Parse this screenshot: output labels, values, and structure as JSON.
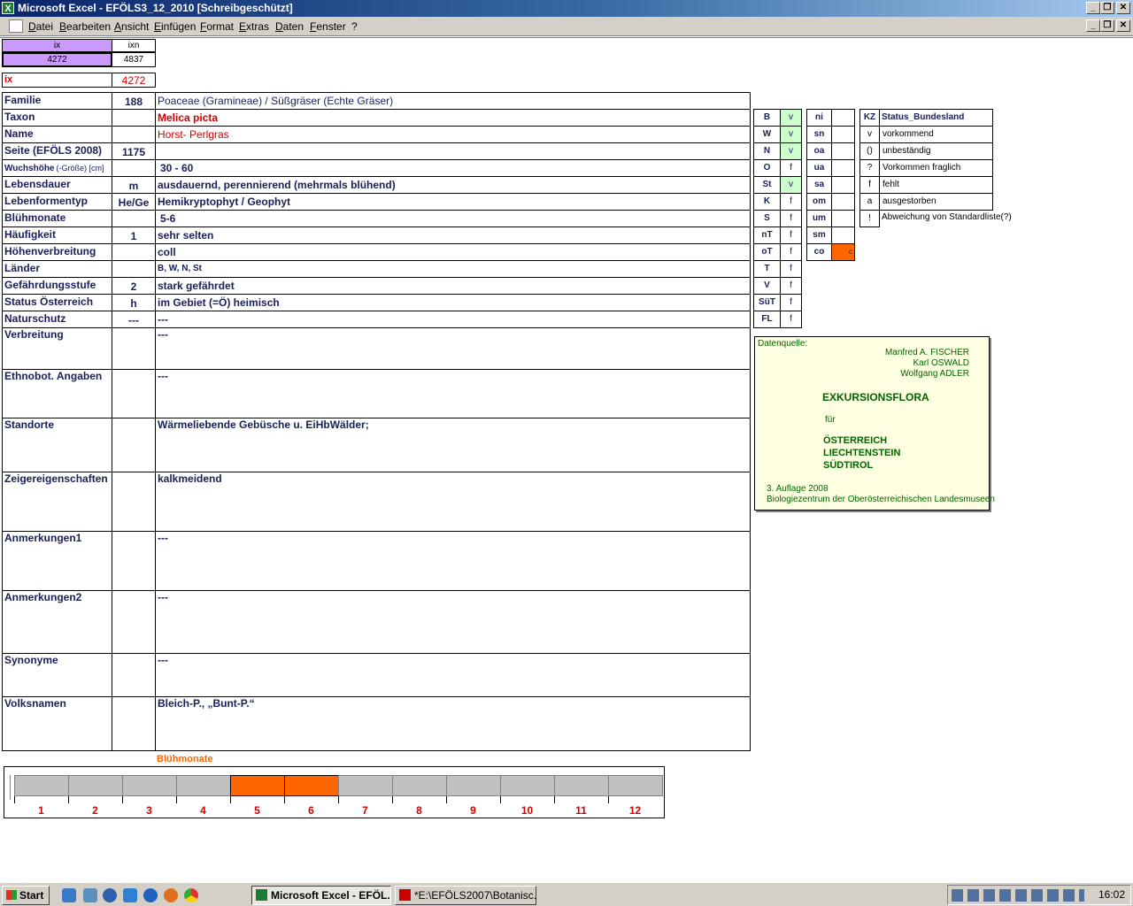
{
  "window": {
    "title": "Microsoft Excel - EFÖLS3_12_2010  [Schreibgeschützt]"
  },
  "menu": [
    "Datei",
    "Bearbeiten",
    "Ansicht",
    "Einfügen",
    "Format",
    "Extras",
    "Daten",
    "Fenster",
    "?"
  ],
  "index": {
    "ix_label": "ix",
    "ixn_label": "ixn",
    "ix_value": "4272",
    "ixn_value": "4837",
    "ix_row_label": "ix",
    "ix_row_value": "4272"
  },
  "fields": [
    {
      "label": "Familie",
      "code": "188",
      "value": "Poaceae (Gramineae)  /  Süßgräser (Echte Gräser)"
    },
    {
      "label": "Taxon",
      "code": "",
      "value": "Melica picta"
    },
    {
      "label": "Name",
      "code": "",
      "value": "Horst- Perlgras"
    },
    {
      "label": "Seite (EFÖLS 2008)",
      "code": "1175",
      "value": ""
    },
    {
      "label": "Wuchshöhe",
      "label_suffix": "(-Größe) [cm]",
      "code": "",
      "value": "30 - 60"
    },
    {
      "label": "Lebensdauer",
      "code": "m",
      "value": "ausdauernd, perennierend (mehrmals blühend)"
    },
    {
      "label": "Lebenformentyp",
      "code": "He/Ge",
      "value": "Hemikryptophyt / Geophyt"
    },
    {
      "label": "Blühmonate",
      "code": "",
      "value": "5-6"
    },
    {
      "label": "Häufigkeit",
      "code": "1",
      "value": "sehr selten"
    },
    {
      "label": "Höhenverbreitung",
      "code": "",
      "value": "coll"
    },
    {
      "label": "Länder",
      "code": "",
      "value": "B, W, N, St"
    },
    {
      "label": "Gefährdungsstufe",
      "code": "2",
      "value": "stark gefährdet"
    },
    {
      "label": "Status Österreich",
      "code": "h",
      "value": "im Gebiet (=Ö) heimisch"
    },
    {
      "label": "Naturschutz",
      "code": "---",
      "value": "---"
    },
    {
      "label": "Verbreitung",
      "code": "",
      "value": "---"
    },
    {
      "label": "Ethnobot. Angaben",
      "code": "",
      "value": "---"
    },
    {
      "label": "Standorte",
      "code": "",
      "value": "Wärmeliebende Gebüsche u. EiHbWälder;"
    },
    {
      "label": "Zeigereigenschaften",
      "code": "",
      "value": "kalkmeidend"
    },
    {
      "label": "Anmerkungen1",
      "code": "",
      "value": "---"
    },
    {
      "label": "Anmerkungen2",
      "code": "",
      "value": "---"
    },
    {
      "label": "Synonyme",
      "code": "",
      "value": "---"
    },
    {
      "label": "Volksnamen",
      "code": "",
      "value": "Bleich-P., „Bunt-P.“"
    }
  ],
  "states": [
    {
      "k": "B",
      "v": "v"
    },
    {
      "k": "W",
      "v": "v"
    },
    {
      "k": "N",
      "v": "v"
    },
    {
      "k": "O",
      "v": "f"
    },
    {
      "k": "St",
      "v": "v"
    },
    {
      "k": "K",
      "v": "f"
    },
    {
      "k": "S",
      "v": "f"
    },
    {
      "k": "nT",
      "v": "f"
    },
    {
      "k": "oT",
      "v": "f"
    },
    {
      "k": "T",
      "v": "f"
    },
    {
      "k": "V",
      "v": "f"
    },
    {
      "k": "SüT",
      "v": "f"
    },
    {
      "k": "FL",
      "v": "f"
    }
  ],
  "altitudes": [
    {
      "k": "ni",
      "v": ""
    },
    {
      "k": "sn",
      "v": ""
    },
    {
      "k": "oa",
      "v": ""
    },
    {
      "k": "ua",
      "v": ""
    },
    {
      "k": "sa",
      "v": ""
    },
    {
      "k": "om",
      "v": ""
    },
    {
      "k": "um",
      "v": ""
    },
    {
      "k": "sm",
      "v": ""
    },
    {
      "k": "co",
      "v": "c"
    }
  ],
  "legend": {
    "kz": "KZ",
    "title": "Status_Bundesland",
    "rows": [
      {
        "k": "v",
        "t": "vorkommend"
      },
      {
        "k": "()",
        "t": "unbeständig"
      },
      {
        "k": "?",
        "t": "Vorkommen fraglich"
      },
      {
        "k": "f",
        "t": "fehlt"
      },
      {
        "k": "a",
        "t": "ausgestorben"
      },
      {
        "k": "!",
        "t": "Abweichung von Standardliste(?)"
      }
    ]
  },
  "source": {
    "heading": "Datenquelle:",
    "authors": [
      "Manfred A. FISCHER",
      "Karl OSWALD",
      "Wolfgang ADLER"
    ],
    "book": "EXKURSIONSFLORA",
    "fuer": "für",
    "regions": [
      "ÖSTERREICH",
      "LIECHTENSTEIN",
      "SÜDTIROL"
    ],
    "edition": "3. Auflage 2008",
    "publisher": "Biologiezentrum der Oberösterreichischen Landesmuseen"
  },
  "bloom": {
    "title": "Blühmonate",
    "months": [
      "1",
      "2",
      "3",
      "4",
      "5",
      "6",
      "7",
      "8",
      "9",
      "10",
      "11",
      "12"
    ],
    "active": [
      5,
      6
    ]
  },
  "colors": {
    "active": "#ff6600",
    "present": "#ccffcc"
  },
  "taskbar": {
    "start": "Start",
    "tasks": [
      "Microsoft Excel - EFÖL...",
      "*E:\\EFÖLS2007\\Botanisc..."
    ],
    "clock": "16:02"
  }
}
